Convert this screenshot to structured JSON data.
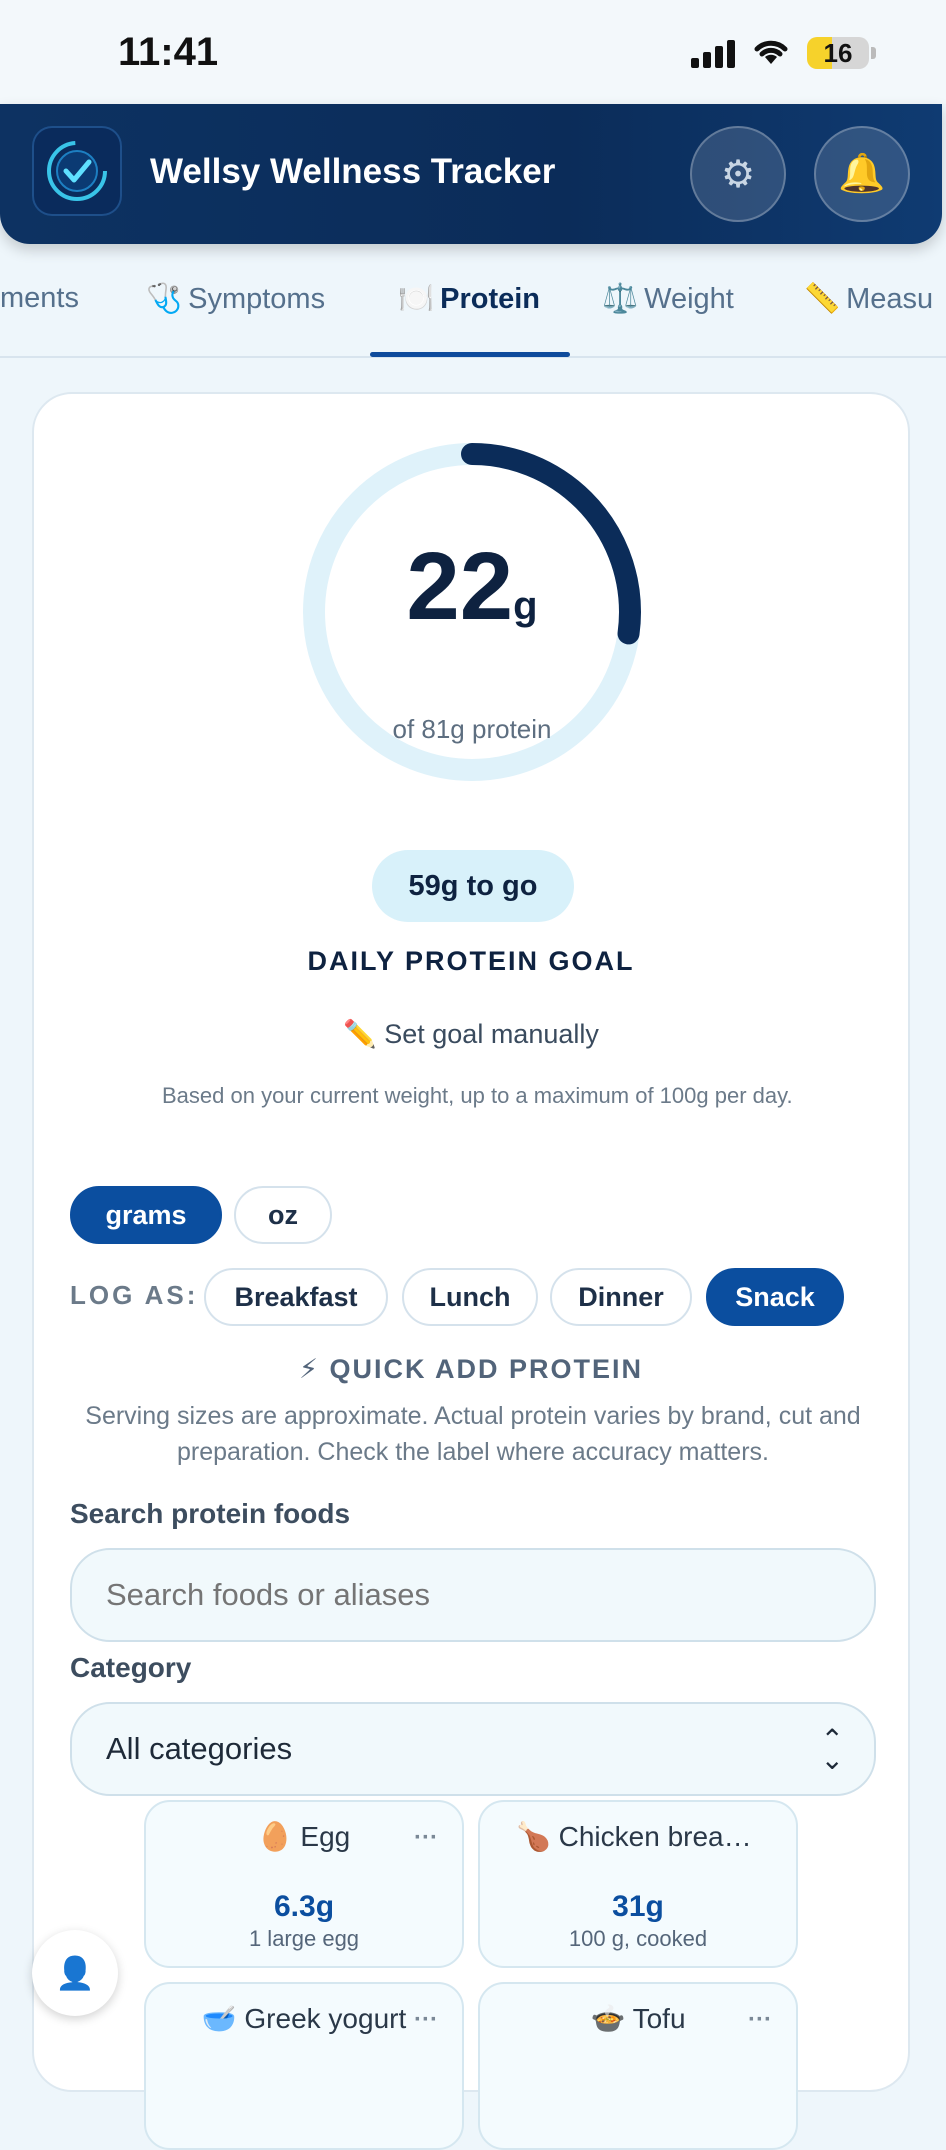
{
  "status": {
    "time": "11:41",
    "battery": "16"
  },
  "header": {
    "title": "Wellsy Wellness Tracker"
  },
  "tabs": [
    {
      "label": "ments",
      "icon": ""
    },
    {
      "label": "Symptoms",
      "icon": "🩺"
    },
    {
      "label": "Protein",
      "icon": "🍽️"
    },
    {
      "label": "Weight",
      "icon": "⚖️"
    },
    {
      "label": "Measu",
      "icon": "📏"
    }
  ],
  "ring": {
    "value": "22",
    "unit": "g",
    "subtitle": "of 81g protein",
    "current": 22,
    "goal": 81
  },
  "goal": {
    "to_go": "59g to go",
    "title": "DAILY PROTEIN GOAL",
    "set_manual": "✏️ Set goal manually",
    "note": "Based on your current weight, up to a maximum of 100g per day."
  },
  "units": {
    "grams": "grams",
    "oz": "oz",
    "selected": "grams"
  },
  "log": {
    "label": "LOG AS:",
    "options": [
      "Breakfast",
      "Lunch",
      "Dinner",
      "Snack"
    ],
    "selected": "Snack"
  },
  "quick_add": {
    "title": "⚡ QUICK ADD PROTEIN",
    "note": "Serving sizes are approximate. Actual protein varies by brand, cut and preparation. Check the label where accuracy matters."
  },
  "search": {
    "label": "Search protein foods",
    "placeholder": "Search foods or aliases"
  },
  "category": {
    "label": "Category",
    "value": "All categories"
  },
  "foods": [
    {
      "name": "🥚 Egg",
      "amount": "6.3g",
      "serving": "1 large egg"
    },
    {
      "name": "🍗 Chicken breast...",
      "amount": "31g",
      "serving": "100 g, cooked"
    },
    {
      "name": "🥣 Greek yogurt",
      "amount": "",
      "serving": ""
    },
    {
      "name": "🍲 Tofu",
      "amount": "",
      "serving": ""
    }
  ],
  "colors": {
    "accent": "#0b4e9f",
    "header": "#0b2c59",
    "ring_track": "#dff2fa",
    "ring_fill": "#0b2c59"
  }
}
